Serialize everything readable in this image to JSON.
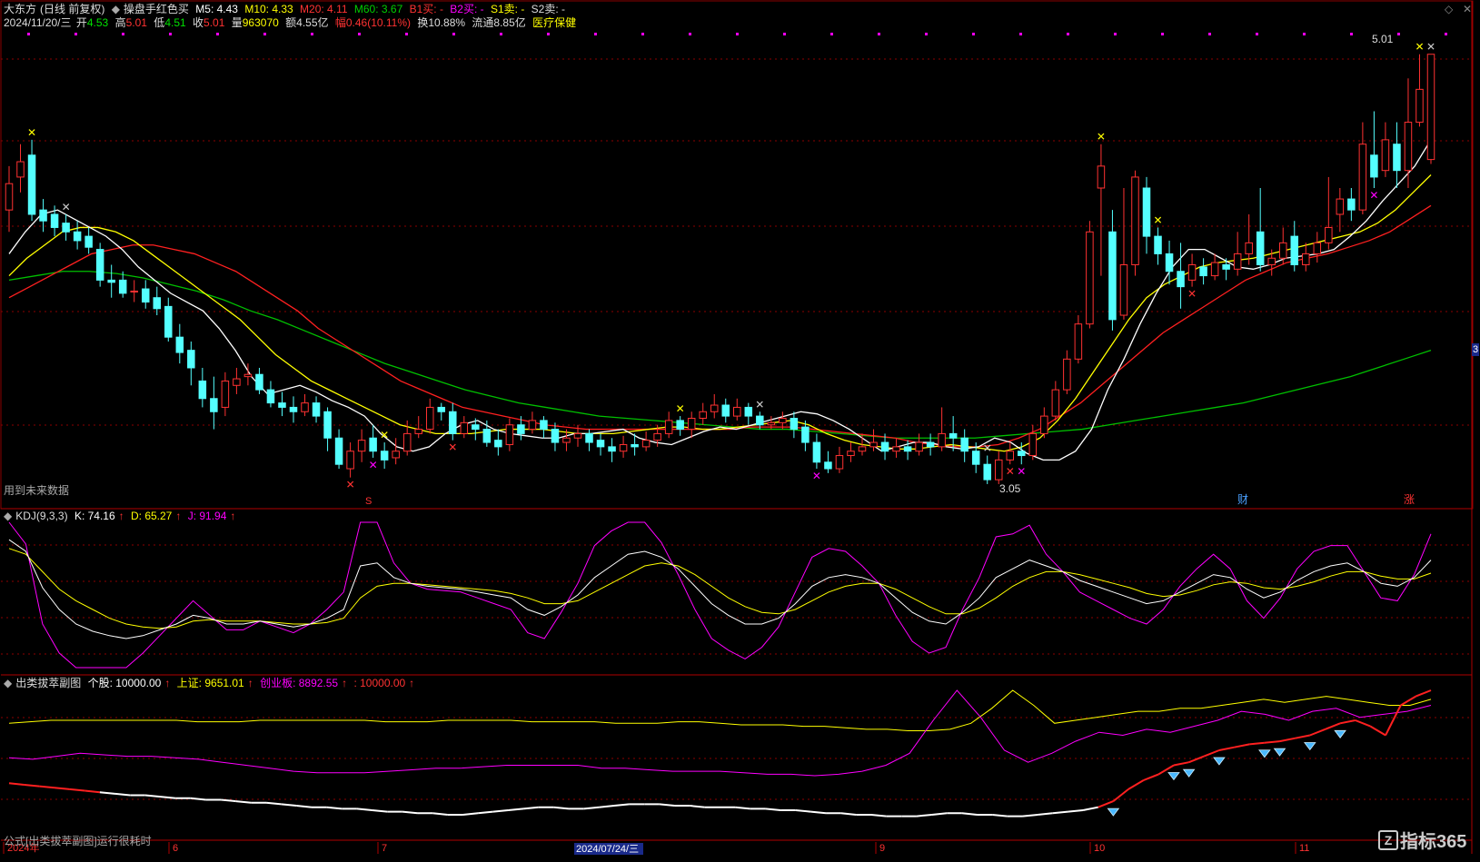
{
  "header": {
    "stock_name": "大东方",
    "mode": "(日线 前复权)",
    "formula": "操盘手红色买",
    "ma5": "M5: 4.43",
    "ma10": "M10: 4.33",
    "ma20": "M20: 4.11",
    "ma60": "M60: 3.67",
    "b1": "B1买: -",
    "b2": "B2买: -",
    "s1": "S1卖: -",
    "s2": "S2卖: -"
  },
  "quote": {
    "date": "2024/11/20/三",
    "open_label": "开",
    "open": "4.53",
    "high_label": "高",
    "high": "5.01",
    "low_label": "低",
    "low": "4.51",
    "close_label": "收",
    "close": "5.01",
    "vol_label": "量",
    "vol": "963070",
    "amount": "额4.55亿",
    "change": "幅0.46(10.11%)",
    "turnover": "换10.88%",
    "float": "流通8.85亿",
    "sector": "医疗保健"
  },
  "price_panel": {
    "future_note": "用到未来数据",
    "high_label": "5.01",
    "low_label": "3.05",
    "marker_s": "S",
    "marker_cai": "财",
    "marker_zhang": "涨",
    "right_tag": "3"
  },
  "kdj": {
    "title": "KDJ(9,3,3)",
    "k": "K: 74.16",
    "d": "D: 65.27",
    "j": "J: 91.94"
  },
  "sub": {
    "title": "出类拔萃副图",
    "stock": "个股: 10000.00",
    "sh": "上证: 9651.01",
    "cy": "创业板: 8892.55",
    "extra": ": 10000.00",
    "note": "公式[出类拔萃副图]运行很耗时"
  },
  "xaxis": {
    "labels": [
      "2024年",
      "6",
      "7",
      "9",
      "10",
      "11"
    ],
    "cursor_date": "2024/07/24/三"
  },
  "watermark": "指标365",
  "colors": {
    "up": "#ff3232",
    "down": "#54ffff",
    "ma5": "#ffffff",
    "ma10": "#ffff00",
    "ma20": "#ff2020",
    "ma60": "#00c000",
    "magenta": "#ff00ff",
    "bg": "#000000"
  },
  "chart_data": {
    "type": "candlestick",
    "title": "大东方 (日线 前复权)",
    "ylim": [
      3.0,
      5.1
    ],
    "candles": [
      [
        4.3,
        4.42,
        4.5,
        4.2
      ],
      [
        4.45,
        4.52,
        4.6,
        4.38
      ],
      [
        4.55,
        4.28,
        4.62,
        4.25
      ],
      [
        4.3,
        4.25,
        4.35,
        4.2
      ],
      [
        4.28,
        4.22,
        4.32,
        4.18
      ],
      [
        4.24,
        4.2,
        4.28,
        4.16
      ],
      [
        4.2,
        4.16,
        4.25,
        4.12
      ],
      [
        4.18,
        4.13,
        4.22,
        4.1
      ],
      [
        4.12,
        3.98,
        4.15,
        3.95
      ],
      [
        3.98,
        3.97,
        4.05,
        3.9
      ],
      [
        3.98,
        3.92,
        4.02,
        3.9
      ],
      [
        3.93,
        3.93,
        3.98,
        3.88
      ],
      [
        3.94,
        3.88,
        3.98,
        3.85
      ],
      [
        3.9,
        3.85,
        3.95,
        3.82
      ],
      [
        3.86,
        3.72,
        3.9,
        3.7
      ],
      [
        3.72,
        3.65,
        3.78,
        3.6
      ],
      [
        3.66,
        3.58,
        3.7,
        3.5
      ],
      [
        3.52,
        3.44,
        3.58,
        3.4
      ],
      [
        3.44,
        3.38,
        3.54,
        3.3
      ],
      [
        3.4,
        3.52,
        3.56,
        3.36
      ],
      [
        3.5,
        3.53,
        3.58,
        3.46
      ],
      [
        3.54,
        3.55,
        3.6,
        3.5
      ],
      [
        3.55,
        3.48,
        3.58,
        3.46
      ],
      [
        3.48,
        3.42,
        3.52,
        3.4
      ],
      [
        3.42,
        3.4,
        3.47,
        3.36
      ],
      [
        3.4,
        3.38,
        3.45,
        3.33
      ],
      [
        3.38,
        3.42,
        3.46,
        3.36
      ],
      [
        3.42,
        3.36,
        3.45,
        3.33
      ],
      [
        3.38,
        3.26,
        3.4,
        3.2
      ],
      [
        3.26,
        3.14,
        3.3,
        3.12
      ],
      [
        3.12,
        3.2,
        3.24,
        3.08
      ],
      [
        3.2,
        3.25,
        3.3,
        3.15
      ],
      [
        3.26,
        3.2,
        3.32,
        3.17
      ],
      [
        3.2,
        3.16,
        3.24,
        3.12
      ],
      [
        3.17,
        3.2,
        3.26,
        3.14
      ],
      [
        3.2,
        3.28,
        3.34,
        3.18
      ],
      [
        3.28,
        3.3,
        3.36,
        3.26
      ],
      [
        3.3,
        3.4,
        3.44,
        3.28
      ],
      [
        3.4,
        3.38,
        3.42,
        3.34
      ],
      [
        3.38,
        3.28,
        3.42,
        3.25
      ],
      [
        3.28,
        3.33,
        3.36,
        3.26
      ],
      [
        3.32,
        3.3,
        3.35,
        3.25
      ],
      [
        3.3,
        3.24,
        3.34,
        3.22
      ],
      [
        3.25,
        3.22,
        3.3,
        3.18
      ],
      [
        3.23,
        3.32,
        3.35,
        3.2
      ],
      [
        3.32,
        3.28,
        3.36,
        3.25
      ],
      [
        3.3,
        3.34,
        3.38,
        3.28
      ],
      [
        3.34,
        3.3,
        3.36,
        3.26
      ],
      [
        3.3,
        3.24,
        3.33,
        3.2
      ],
      [
        3.24,
        3.26,
        3.3,
        3.2
      ],
      [
        3.26,
        3.28,
        3.32,
        3.22
      ],
      [
        3.28,
        3.24,
        3.3,
        3.2
      ],
      [
        3.25,
        3.22,
        3.28,
        3.18
      ],
      [
        3.22,
        3.2,
        3.26,
        3.15
      ],
      [
        3.2,
        3.23,
        3.27,
        3.17
      ],
      [
        3.23,
        3.22,
        3.28,
        3.18
      ],
      [
        3.22,
        3.25,
        3.29,
        3.2
      ],
      [
        3.25,
        3.28,
        3.32,
        3.22
      ],
      [
        3.28,
        3.34,
        3.38,
        3.26
      ],
      [
        3.34,
        3.3,
        3.36,
        3.27
      ],
      [
        3.3,
        3.35,
        3.38,
        3.26
      ],
      [
        3.35,
        3.38,
        3.42,
        3.32
      ],
      [
        3.38,
        3.41,
        3.46,
        3.35
      ],
      [
        3.41,
        3.36,
        3.44,
        3.33
      ],
      [
        3.36,
        3.4,
        3.44,
        3.34
      ],
      [
        3.4,
        3.36,
        3.42,
        3.32
      ],
      [
        3.36,
        3.32,
        3.38,
        3.3
      ],
      [
        3.32,
        3.33,
        3.36,
        3.3
      ],
      [
        3.33,
        3.35,
        3.38,
        3.3
      ],
      [
        3.35,
        3.3,
        3.38,
        3.26
      ],
      [
        3.31,
        3.24,
        3.34,
        3.2
      ],
      [
        3.24,
        3.15,
        3.28,
        3.12
      ],
      [
        3.15,
        3.12,
        3.2,
        3.1
      ],
      [
        3.12,
        3.18,
        3.22,
        3.1
      ],
      [
        3.18,
        3.2,
        3.24,
        3.15
      ],
      [
        3.2,
        3.22,
        3.28,
        3.18
      ],
      [
        3.22,
        3.24,
        3.3,
        3.2
      ],
      [
        3.24,
        3.2,
        3.28,
        3.16
      ],
      [
        3.2,
        3.22,
        3.26,
        3.17
      ],
      [
        3.22,
        3.2,
        3.25,
        3.16
      ],
      [
        3.2,
        3.24,
        3.28,
        3.18
      ],
      [
        3.24,
        3.22,
        3.28,
        3.18
      ],
      [
        3.22,
        3.28,
        3.4,
        3.2
      ],
      [
        3.28,
        3.26,
        3.36,
        3.2
      ],
      [
        3.26,
        3.2,
        3.3,
        3.15
      ],
      [
        3.2,
        3.14,
        3.24,
        3.1
      ],
      [
        3.14,
        3.07,
        3.18,
        3.05
      ],
      [
        3.07,
        3.16,
        3.2,
        3.05
      ],
      [
        3.16,
        3.2,
        3.24,
        3.14
      ],
      [
        3.2,
        3.18,
        3.24,
        3.14
      ],
      [
        3.18,
        3.28,
        3.32,
        3.16
      ],
      [
        3.28,
        3.36,
        3.4,
        3.26
      ],
      [
        3.36,
        3.48,
        3.52,
        3.34
      ],
      [
        3.48,
        3.62,
        3.66,
        3.46
      ],
      [
        3.62,
        3.78,
        3.82,
        3.6
      ],
      [
        3.78,
        4.2,
        4.25,
        3.76
      ],
      [
        4.4,
        4.5,
        4.6,
        4.0
      ],
      [
        4.2,
        3.8,
        4.3,
        3.75
      ],
      [
        3.82,
        4.05,
        4.4,
        3.8
      ],
      [
        4.05,
        4.45,
        4.48,
        4.0
      ],
      [
        4.4,
        4.18,
        4.45,
        4.1
      ],
      [
        4.18,
        4.1,
        4.22,
        4.05
      ],
      [
        4.1,
        4.02,
        4.16,
        3.96
      ],
      [
        4.02,
        3.95,
        4.15,
        3.85
      ],
      [
        3.98,
        4.05,
        4.1,
        3.95
      ],
      [
        4.04,
        4.0,
        4.08,
        3.96
      ],
      [
        4.0,
        4.06,
        4.1,
        3.98
      ],
      [
        4.05,
        4.03,
        4.08,
        3.98
      ],
      [
        4.03,
        4.1,
        4.2,
        4.0
      ],
      [
        4.1,
        4.15,
        4.28,
        4.05
      ],
      [
        4.2,
        4.05,
        4.4,
        4.02
      ],
      [
        4.05,
        4.08,
        4.12,
        4.0
      ],
      [
        4.08,
        4.15,
        4.22,
        4.05
      ],
      [
        4.18,
        4.05,
        4.25,
        4.02
      ],
      [
        4.05,
        4.1,
        4.15,
        4.02
      ],
      [
        4.1,
        4.15,
        4.2,
        4.06
      ],
      [
        4.15,
        4.22,
        4.45,
        4.12
      ],
      [
        4.28,
        4.35,
        4.4,
        4.2
      ],
      [
        4.35,
        4.3,
        4.4,
        4.25
      ],
      [
        4.3,
        4.6,
        4.7,
        4.28
      ],
      [
        4.55,
        4.45,
        4.75,
        4.4
      ],
      [
        4.48,
        4.62,
        4.7,
        4.45
      ],
      [
        4.6,
        4.48,
        4.7,
        4.4
      ],
      [
        4.48,
        4.7,
        4.9,
        4.4
      ],
      [
        4.7,
        4.85,
        5.01,
        4.68
      ],
      [
        4.53,
        5.01,
        5.01,
        4.51
      ]
    ],
    "ma5": [
      4.1,
      4.2,
      4.28,
      4.3,
      4.26,
      4.22,
      4.18,
      4.12,
      4.04,
      3.98,
      3.92,
      3.88,
      3.84,
      3.76,
      3.66,
      3.54,
      3.46,
      3.48,
      3.5,
      3.47,
      3.43,
      3.4,
      3.36,
      3.28,
      3.22,
      3.2,
      3.22,
      3.28,
      3.32,
      3.34,
      3.3,
      3.28,
      3.27,
      3.26,
      3.26,
      3.28,
      3.28,
      3.29,
      3.3,
      3.26,
      3.24,
      3.23,
      3.26,
      3.29,
      3.31,
      3.3,
      3.32,
      3.34,
      3.36,
      3.38,
      3.37,
      3.34,
      3.3,
      3.25,
      3.2,
      3.22,
      3.24,
      3.24,
      3.22,
      3.21,
      3.22,
      3.26,
      3.24,
      3.19,
      3.16,
      3.16,
      3.2,
      3.3,
      3.48,
      3.62,
      3.78,
      3.92,
      4.04,
      4.12,
      4.12,
      4.08,
      4.04,
      4.03,
      4.05,
      4.08,
      4.09,
      4.1,
      4.12,
      4.18,
      4.25,
      4.34,
      4.42,
      4.5,
      4.62
    ],
    "ma10": [
      4.0,
      4.08,
      4.14,
      4.2,
      4.22,
      4.22,
      4.2,
      4.16,
      4.1,
      4.04,
      3.98,
      3.92,
      3.86,
      3.8,
      3.72,
      3.64,
      3.58,
      3.52,
      3.48,
      3.44,
      3.4,
      3.36,
      3.32,
      3.3,
      3.28,
      3.28,
      3.28,
      3.29,
      3.3,
      3.3,
      3.3,
      3.29,
      3.28,
      3.28,
      3.28,
      3.29,
      3.3,
      3.31,
      3.31,
      3.3,
      3.3,
      3.31,
      3.32,
      3.33,
      3.34,
      3.32,
      3.28,
      3.25,
      3.23,
      3.22,
      3.21,
      3.21,
      3.22,
      3.23,
      3.22,
      3.21,
      3.2,
      3.22,
      3.26,
      3.34,
      3.44,
      3.56,
      3.68,
      3.8,
      3.9,
      3.96,
      4.0,
      4.04,
      4.06,
      4.07,
      4.08,
      4.1,
      4.12,
      4.14,
      4.16,
      4.18,
      4.2,
      4.24,
      4.3,
      4.38,
      4.46
    ],
    "ma20": [
      3.9,
      3.95,
      4.0,
      4.05,
      4.1,
      4.12,
      4.14,
      4.14,
      4.12,
      4.1,
      4.06,
      4.02,
      3.96,
      3.9,
      3.84,
      3.76,
      3.7,
      3.64,
      3.58,
      3.52,
      3.48,
      3.44,
      3.4,
      3.38,
      3.36,
      3.34,
      3.32,
      3.31,
      3.3,
      3.3,
      3.3,
      3.3,
      3.3,
      3.3,
      3.3,
      3.3,
      3.31,
      3.31,
      3.31,
      3.3,
      3.29,
      3.28,
      3.27,
      3.26,
      3.24,
      3.23,
      3.22,
      3.22,
      3.23,
      3.26,
      3.3,
      3.36,
      3.42,
      3.5,
      3.58,
      3.66,
      3.74,
      3.8,
      3.86,
      3.92,
      3.98,
      4.02,
      4.06,
      4.08,
      4.1,
      4.13,
      4.16,
      4.2,
      4.26,
      4.32
    ],
    "ma60": [
      3.98,
      4.0,
      4.02,
      4.02,
      4.01,
      3.99,
      3.96,
      3.93,
      3.89,
      3.84,
      3.8,
      3.75,
      3.7,
      3.65,
      3.6,
      3.56,
      3.52,
      3.48,
      3.45,
      3.42,
      3.4,
      3.38,
      3.36,
      3.35,
      3.34,
      3.33,
      3.32,
      3.31,
      3.3,
      3.3,
      3.29,
      3.28,
      3.27,
      3.26,
      3.26,
      3.26,
      3.26,
      3.27,
      3.28,
      3.29,
      3.3,
      3.32,
      3.34,
      3.36,
      3.38,
      3.4,
      3.42,
      3.45,
      3.48,
      3.51,
      3.54,
      3.58,
      3.62,
      3.66
    ],
    "kdj_k": [
      88,
      80,
      55,
      40,
      30,
      25,
      22,
      20,
      22,
      26,
      30,
      36,
      34,
      30,
      30,
      32,
      30,
      28,
      30,
      34,
      40,
      70,
      72,
      62,
      58,
      56,
      55,
      54,
      52,
      50,
      48,
      40,
      36,
      42,
      50,
      62,
      70,
      78,
      80,
      76,
      68,
      56,
      44,
      36,
      30,
      30,
      34,
      44,
      56,
      62,
      64,
      62,
      58,
      48,
      38,
      32,
      30,
      38,
      48,
      62,
      68,
      74,
      70,
      66,
      60,
      56,
      52,
      48,
      44,
      46,
      52,
      58,
      64,
      62,
      54,
      48,
      52,
      60,
      66,
      70,
      72,
      66,
      58,
      56,
      62,
      74
    ],
    "kdj_d": [
      82,
      78,
      66,
      54,
      46,
      40,
      34,
      30,
      28,
      27,
      28,
      32,
      33,
      32,
      32,
      32,
      31,
      30,
      30,
      31,
      34,
      48,
      56,
      58,
      58,
      57,
      56,
      55,
      54,
      53,
      51,
      48,
      44,
      44,
      46,
      52,
      58,
      64,
      70,
      72,
      70,
      64,
      56,
      48,
      42,
      38,
      37,
      40,
      46,
      52,
      56,
      58,
      58,
      54,
      48,
      42,
      37,
      37,
      41,
      48,
      56,
      62,
      66,
      66,
      64,
      61,
      58,
      55,
      51,
      49,
      50,
      53,
      57,
      59,
      58,
      55,
      54,
      56,
      59,
      63,
      66,
      66,
      63,
      61,
      61,
      65
    ],
    "kdj_j": [
      100,
      85,
      30,
      10,
      0,
      0,
      0,
      0,
      10,
      22,
      34,
      46,
      36,
      26,
      26,
      32,
      28,
      24,
      30,
      40,
      52,
      100,
      100,
      72,
      58,
      54,
      53,
      52,
      48,
      44,
      40,
      24,
      20,
      38,
      58,
      84,
      94,
      100,
      100,
      86,
      64,
      40,
      20,
      12,
      6,
      14,
      28,
      52,
      76,
      82,
      80,
      70,
      58,
      36,
      18,
      10,
      14,
      40,
      62,
      90,
      92,
      98,
      78,
      66,
      52,
      46,
      40,
      34,
      30,
      40,
      56,
      68,
      78,
      68,
      46,
      34,
      48,
      68,
      80,
      84,
      84,
      66,
      48,
      46,
      64,
      92
    ],
    "sub_yellow": [
      78,
      79,
      80,
      80,
      80,
      80,
      80,
      80,
      80,
      79,
      79,
      79,
      80,
      80,
      80,
      80,
      80,
      80,
      79,
      79,
      79,
      80,
      80,
      80,
      80,
      79,
      79,
      79,
      79,
      78,
      78,
      78,
      79,
      79,
      78,
      77,
      77,
      77,
      76,
      76,
      75,
      74,
      74,
      73,
      73,
      74,
      78,
      88,
      100,
      90,
      78,
      80,
      82,
      84,
      86,
      86,
      88,
      88,
      90,
      92,
      94,
      92,
      94,
      96,
      94,
      92,
      90,
      90,
      94
    ],
    "sub_magenta": [
      55,
      54,
      56,
      58,
      57,
      56,
      56,
      55,
      54,
      52,
      50,
      48,
      46,
      45,
      45,
      45,
      46,
      47,
      48,
      48,
      49,
      50,
      50,
      50,
      50,
      48,
      48,
      47,
      46,
      46,
      46,
      45,
      44,
      44,
      43,
      44,
      46,
      50,
      58,
      80,
      100,
      82,
      60,
      52,
      58,
      66,
      72,
      70,
      74,
      72,
      76,
      80,
      86,
      84,
      80,
      86,
      88,
      82,
      84,
      86,
      90
    ],
    "sub_main": [
      38,
      37,
      36,
      35,
      34,
      33,
      32,
      31,
      30,
      30,
      29,
      28,
      28,
      27,
      27,
      26,
      25,
      25,
      24,
      23,
      22,
      22,
      21,
      21,
      20,
      19,
      19,
      18,
      18,
      17,
      17,
      18,
      19,
      20,
      21,
      22,
      22,
      21,
      21,
      22,
      23,
      24,
      24,
      24,
      23,
      23,
      22,
      22,
      22,
      21,
      21,
      20,
      20,
      19,
      18,
      18,
      17,
      17,
      16,
      16,
      16,
      17,
      18,
      18,
      17,
      17,
      16,
      16,
      17,
      18,
      19,
      20,
      22,
      26,
      34,
      40,
      44,
      50,
      52,
      56,
      60,
      62,
      64,
      65,
      66,
      68,
      70,
      74,
      78,
      80,
      76,
      70,
      90,
      96,
      100
    ]
  }
}
